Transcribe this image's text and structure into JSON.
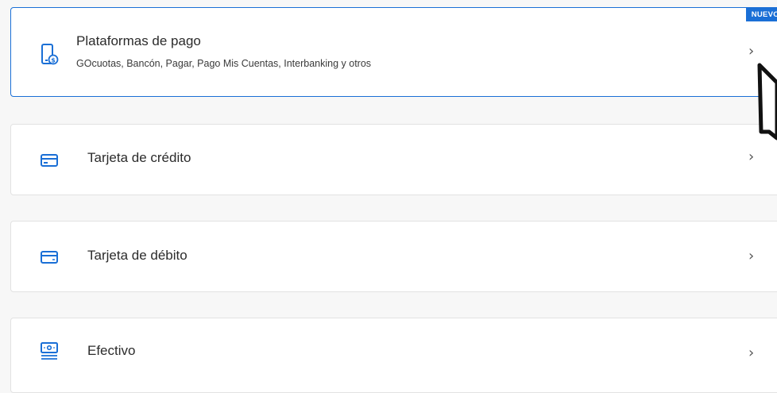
{
  "payment_options": [
    {
      "title": "Plataformas de pago",
      "subtitle": "GOcuotas, Bancón, Pagar, Pago Mis Cuentas, Interbanking y otros",
      "badge": "NUEVO",
      "icon": "phone-payment-icon",
      "selected": true
    },
    {
      "title": "Tarjeta de crédito",
      "icon": "credit-card-icon"
    },
    {
      "title": "Tarjeta de débito",
      "icon": "debit-card-icon"
    },
    {
      "title": "Efectivo",
      "icon": "cash-icon"
    }
  ],
  "chevron": "›",
  "colors": {
    "accent": "#1a6fd6",
    "icon": "#1a6fd6",
    "border": "#e2e2e2",
    "background": "#f7f7f7"
  }
}
